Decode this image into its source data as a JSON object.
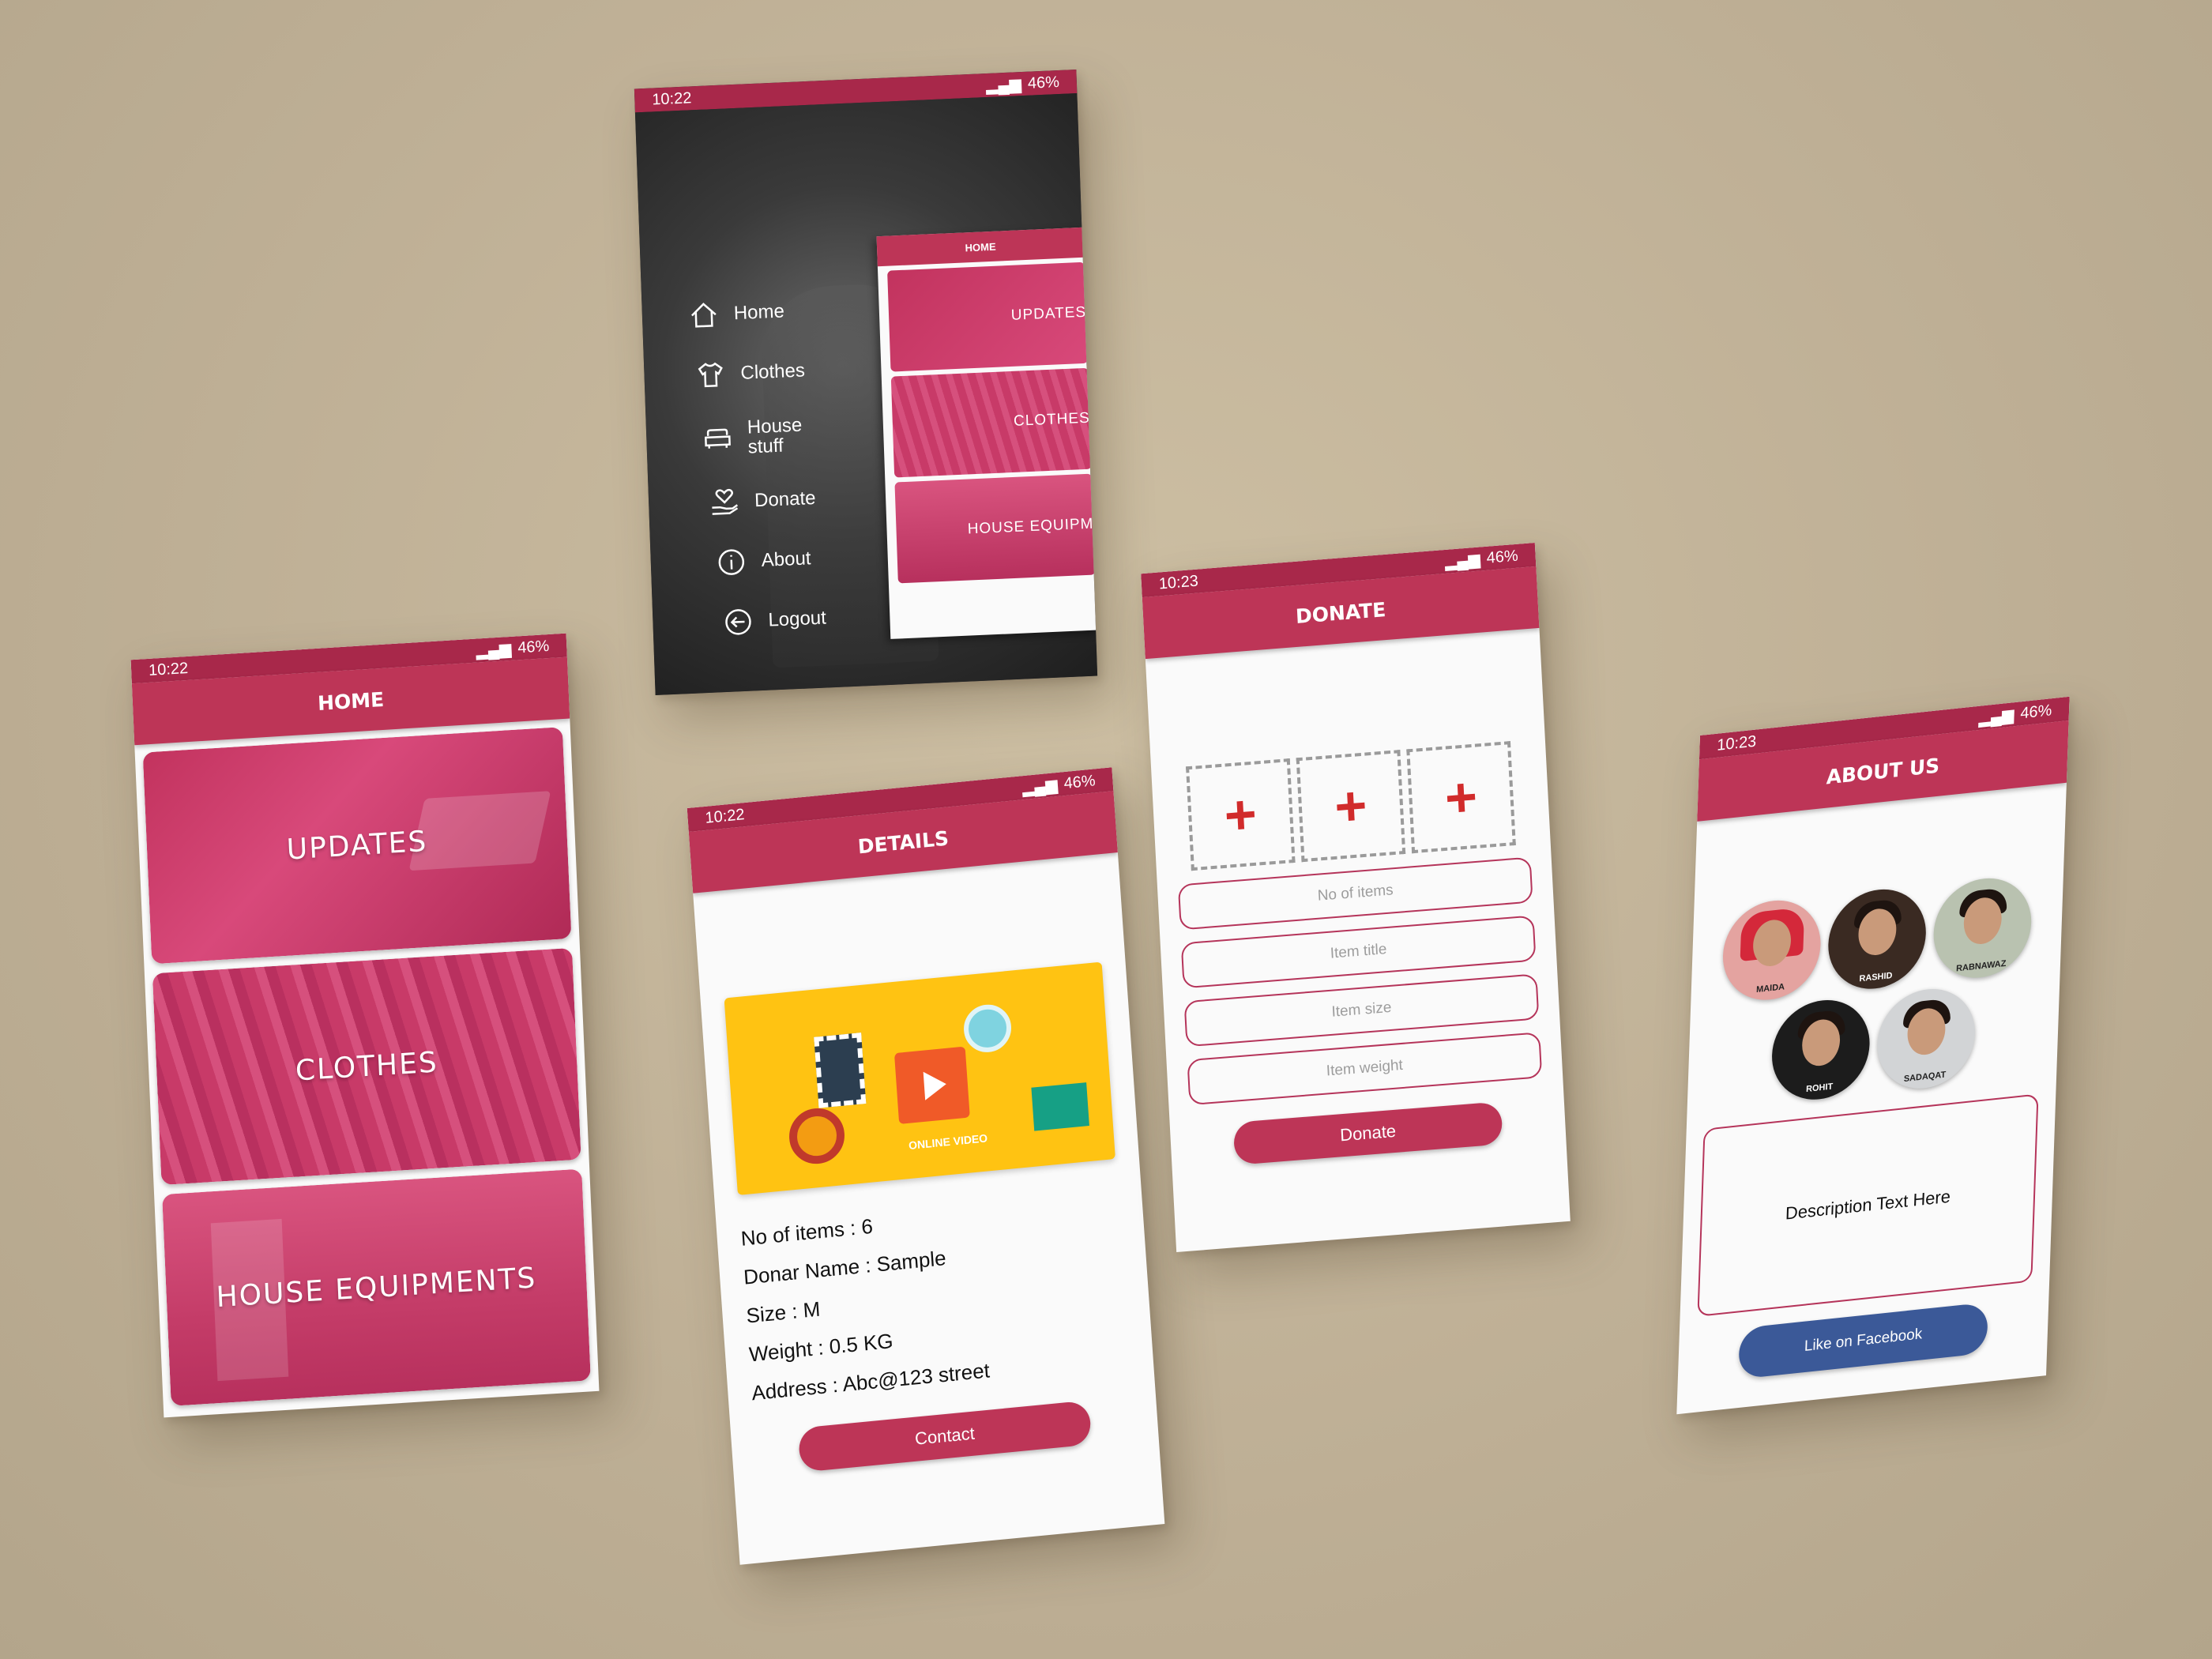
{
  "status": {
    "time_a": "10:22",
    "time_b": "10:23",
    "battery": "46%"
  },
  "colors": {
    "primary": "#bd3557",
    "statusbar": "#a8284a",
    "facebook": "#3b5998",
    "add_cross": "#d12b2b"
  },
  "home": {
    "title": "HOME",
    "cards": [
      {
        "label": "UPDATES"
      },
      {
        "label": "CLOTHES"
      },
      {
        "label": "HOUSE EQUIPMENTS"
      }
    ]
  },
  "drawer": {
    "items": [
      {
        "label": "Home",
        "icon": "home-icon"
      },
      {
        "label": "Clothes",
        "icon": "shirt-icon"
      },
      {
        "label": "House stuff",
        "icon": "sofa-icon"
      },
      {
        "label": "Donate",
        "icon": "heart-hand-icon"
      },
      {
        "label": "About",
        "icon": "info-icon"
      },
      {
        "label": "Logout",
        "icon": "logout-icon"
      }
    ],
    "preview": {
      "title": "HOME",
      "cards": [
        "UPDATES",
        "CLOTHES",
        "HOUSE EQUIPM"
      ]
    }
  },
  "details": {
    "title": "DETAILS",
    "image_caption": "ONLINE VIDEO",
    "lines": [
      "No of items : 6",
      "Donar Name : Sample",
      "Size : M",
      "Weight : 0.5 KG",
      "Address : Abc@123 street"
    ],
    "contact_label": "Contact"
  },
  "donate": {
    "title": "DONATE",
    "add_symbol": "+",
    "fields": [
      {
        "placeholder": "No of items"
      },
      {
        "placeholder": "Item title"
      },
      {
        "placeholder": "Item size"
      },
      {
        "placeholder": "Item weight"
      }
    ],
    "button_label": "Donate"
  },
  "about": {
    "title": "ABOUT US",
    "team": [
      {
        "name": "MAIDA"
      },
      {
        "name": "RASHID"
      },
      {
        "name": "RABNAWAZ"
      },
      {
        "name": "ROHIT"
      },
      {
        "name": "SADAQAT"
      }
    ],
    "description": "Description Text Here",
    "facebook_label": "Like on Facebook"
  }
}
